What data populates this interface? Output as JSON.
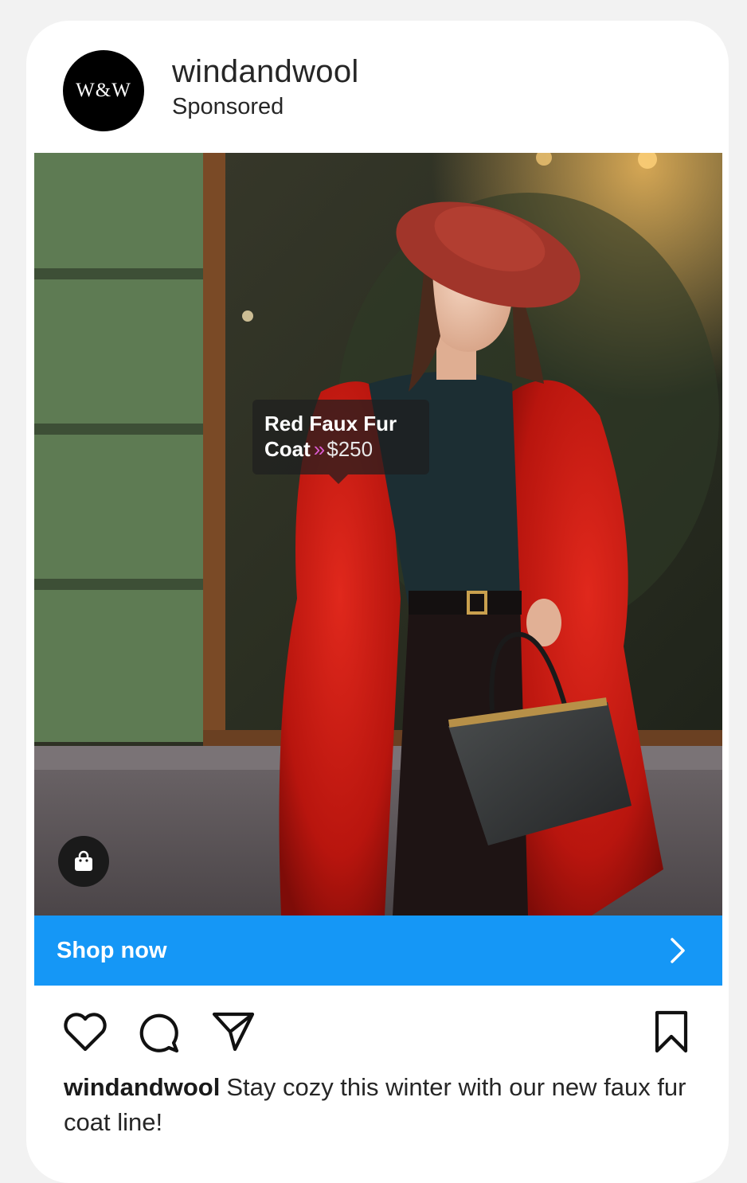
{
  "post": {
    "avatar_text": "W&W",
    "username": "windandwool",
    "sponsored_label": "Sponsored"
  },
  "product_tag": {
    "name_line1": "Red Faux Fur",
    "name_line2": "Coat",
    "arrow": "»",
    "price": "$250"
  },
  "shop_bar": {
    "label": "Shop now",
    "color": "#1597f6"
  },
  "actions": {
    "icons": [
      "heart-icon",
      "comment-icon",
      "share-icon",
      "bookmark-icon"
    ]
  },
  "caption": {
    "username": "windandwool",
    "text": "Stay cozy this winter with our new faux fur coat line!"
  }
}
